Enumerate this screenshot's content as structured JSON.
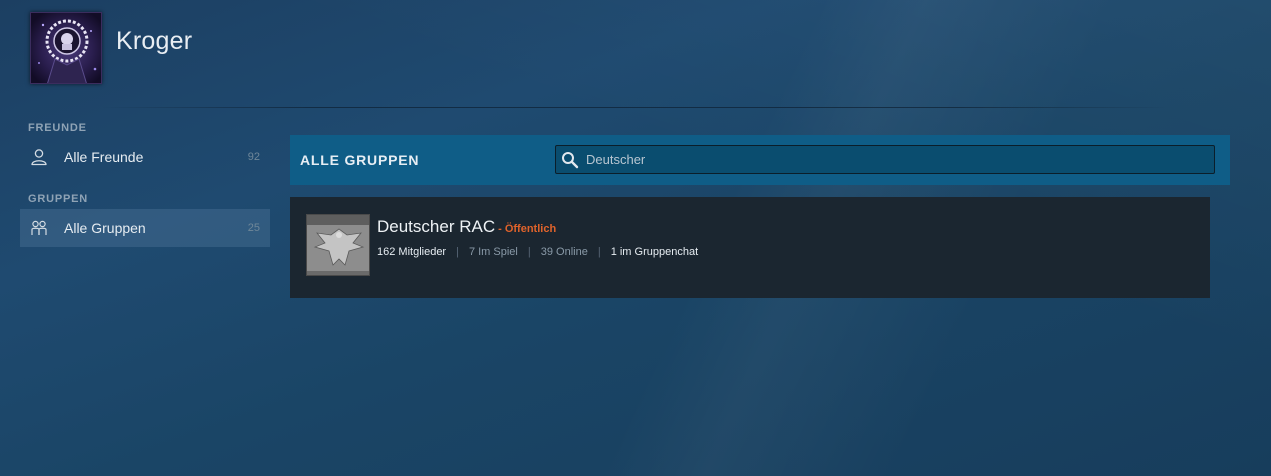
{
  "profile": {
    "name": "Kroger"
  },
  "sidebar": {
    "sections": [
      {
        "title": "FREUNDE",
        "items": [
          {
            "label": "Alle Freunde",
            "count": "92",
            "icon": "person-icon",
            "active": false
          }
        ]
      },
      {
        "title": "GRUPPEN",
        "items": [
          {
            "label": "Alle Gruppen",
            "count": "25",
            "icon": "group-icon",
            "active": true
          }
        ]
      }
    ]
  },
  "main": {
    "title": "ALLE GRUPPEN",
    "search": {
      "value": "Deutscher",
      "icon": "search-icon"
    },
    "groups": [
      {
        "name": "Deutscher RAC",
        "visibility": "- Öffentlich",
        "members": "162 Mitglieder",
        "in_game": "7 Im Spiel",
        "online": "39 Online",
        "in_chat": "1 im Gruppenchat",
        "avatar_text": "Deutscher RAC"
      }
    ]
  },
  "colors": {
    "toolbar_bg": "#0f5d87",
    "card_bg": "#1b2630",
    "visibility_accent": "#e0632b"
  }
}
